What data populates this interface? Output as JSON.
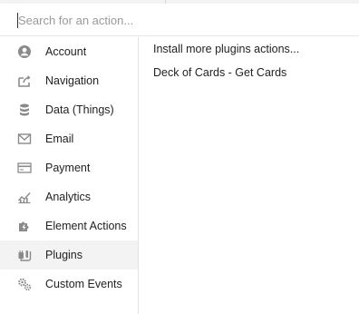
{
  "search": {
    "placeholder": "Search for an action..."
  },
  "sidebar": {
    "items": [
      {
        "label": "Account",
        "icon": "user-circle-icon"
      },
      {
        "label": "Navigation",
        "icon": "external-link-icon"
      },
      {
        "label": "Data (Things)",
        "icon": "database-icon"
      },
      {
        "label": "Email",
        "icon": "envelope-icon"
      },
      {
        "label": "Payment",
        "icon": "credit-card-icon"
      },
      {
        "label": "Analytics",
        "icon": "line-chart-icon"
      },
      {
        "label": "Element Actions",
        "icon": "puzzle-lightning-icon"
      },
      {
        "label": "Plugins",
        "icon": "plug-icon"
      },
      {
        "label": "Custom Events",
        "icon": "gears-icon"
      }
    ],
    "selected": "Plugins"
  },
  "actions": {
    "items": [
      {
        "label": "Install more plugins actions..."
      },
      {
        "label": "Deck of Cards - Get Cards"
      }
    ]
  },
  "colors": {
    "icon": "#8a8a8a",
    "selected_bg": "#f3f3f3",
    "divider": "#e3e3e3"
  }
}
